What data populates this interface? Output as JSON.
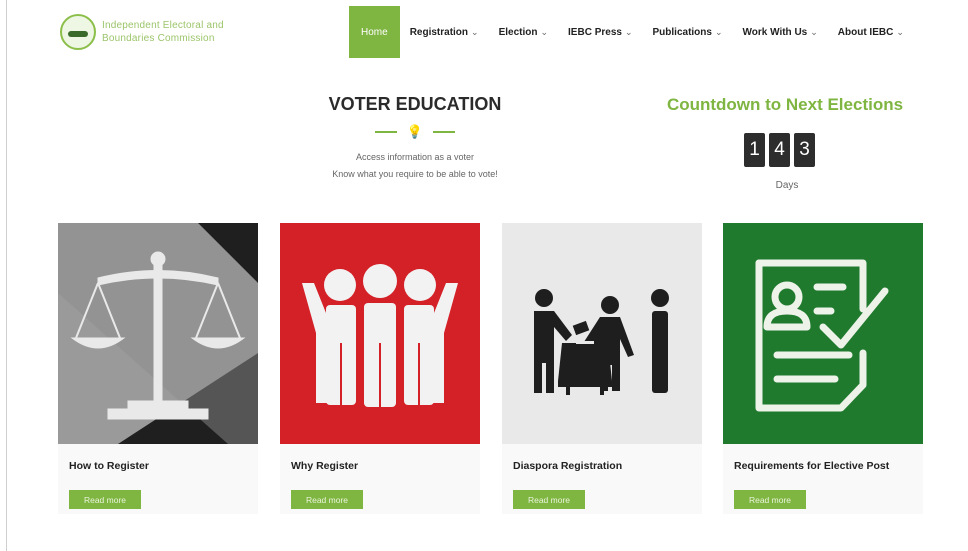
{
  "brand": {
    "logo_line1": "Independent Electoral and",
    "logo_line2": "Boundaries Commission"
  },
  "nav": {
    "items": [
      {
        "label": "Home",
        "active": true,
        "has_dropdown": false
      },
      {
        "label": "Registration",
        "active": false,
        "has_dropdown": true
      },
      {
        "label": "Election",
        "active": false,
        "has_dropdown": true
      },
      {
        "label": "IEBC Press",
        "active": false,
        "has_dropdown": true
      },
      {
        "label": "Publications",
        "active": false,
        "has_dropdown": true
      },
      {
        "label": "Work With Us",
        "active": false,
        "has_dropdown": true
      },
      {
        "label": "About IEBC",
        "active": false,
        "has_dropdown": true
      }
    ]
  },
  "voter_education": {
    "title": "VOTER EDUCATION",
    "divider_icon": "lightbulb-icon",
    "subtitle_line1": "Access information as a voter",
    "subtitle_line2": "Know what you require to be able to vote!"
  },
  "countdown": {
    "title": "Countdown to Next Elections",
    "digits": [
      "1",
      "4",
      "3"
    ],
    "unit": "Days"
  },
  "cards": [
    {
      "title": "How to Register",
      "button": "Read more",
      "icon": "scales-of-justice-icon",
      "bg": "#2a2a2a"
    },
    {
      "title": "Why Register",
      "button": "Read more",
      "icon": "people-group-icon",
      "bg": "#d42027"
    },
    {
      "title": "Diaspora Registration",
      "button": "Read more",
      "icon": "voting-ballot-box-icon",
      "bg": "#e9e9e9"
    },
    {
      "title": "Requirements for Elective Post",
      "button": "Read more",
      "icon": "document-checkmark-icon",
      "bg": "#1f7a2e"
    }
  ],
  "colors": {
    "accent": "#7fb541",
    "text_dark": "#222222",
    "digit_bg": "#2d2d2d"
  }
}
